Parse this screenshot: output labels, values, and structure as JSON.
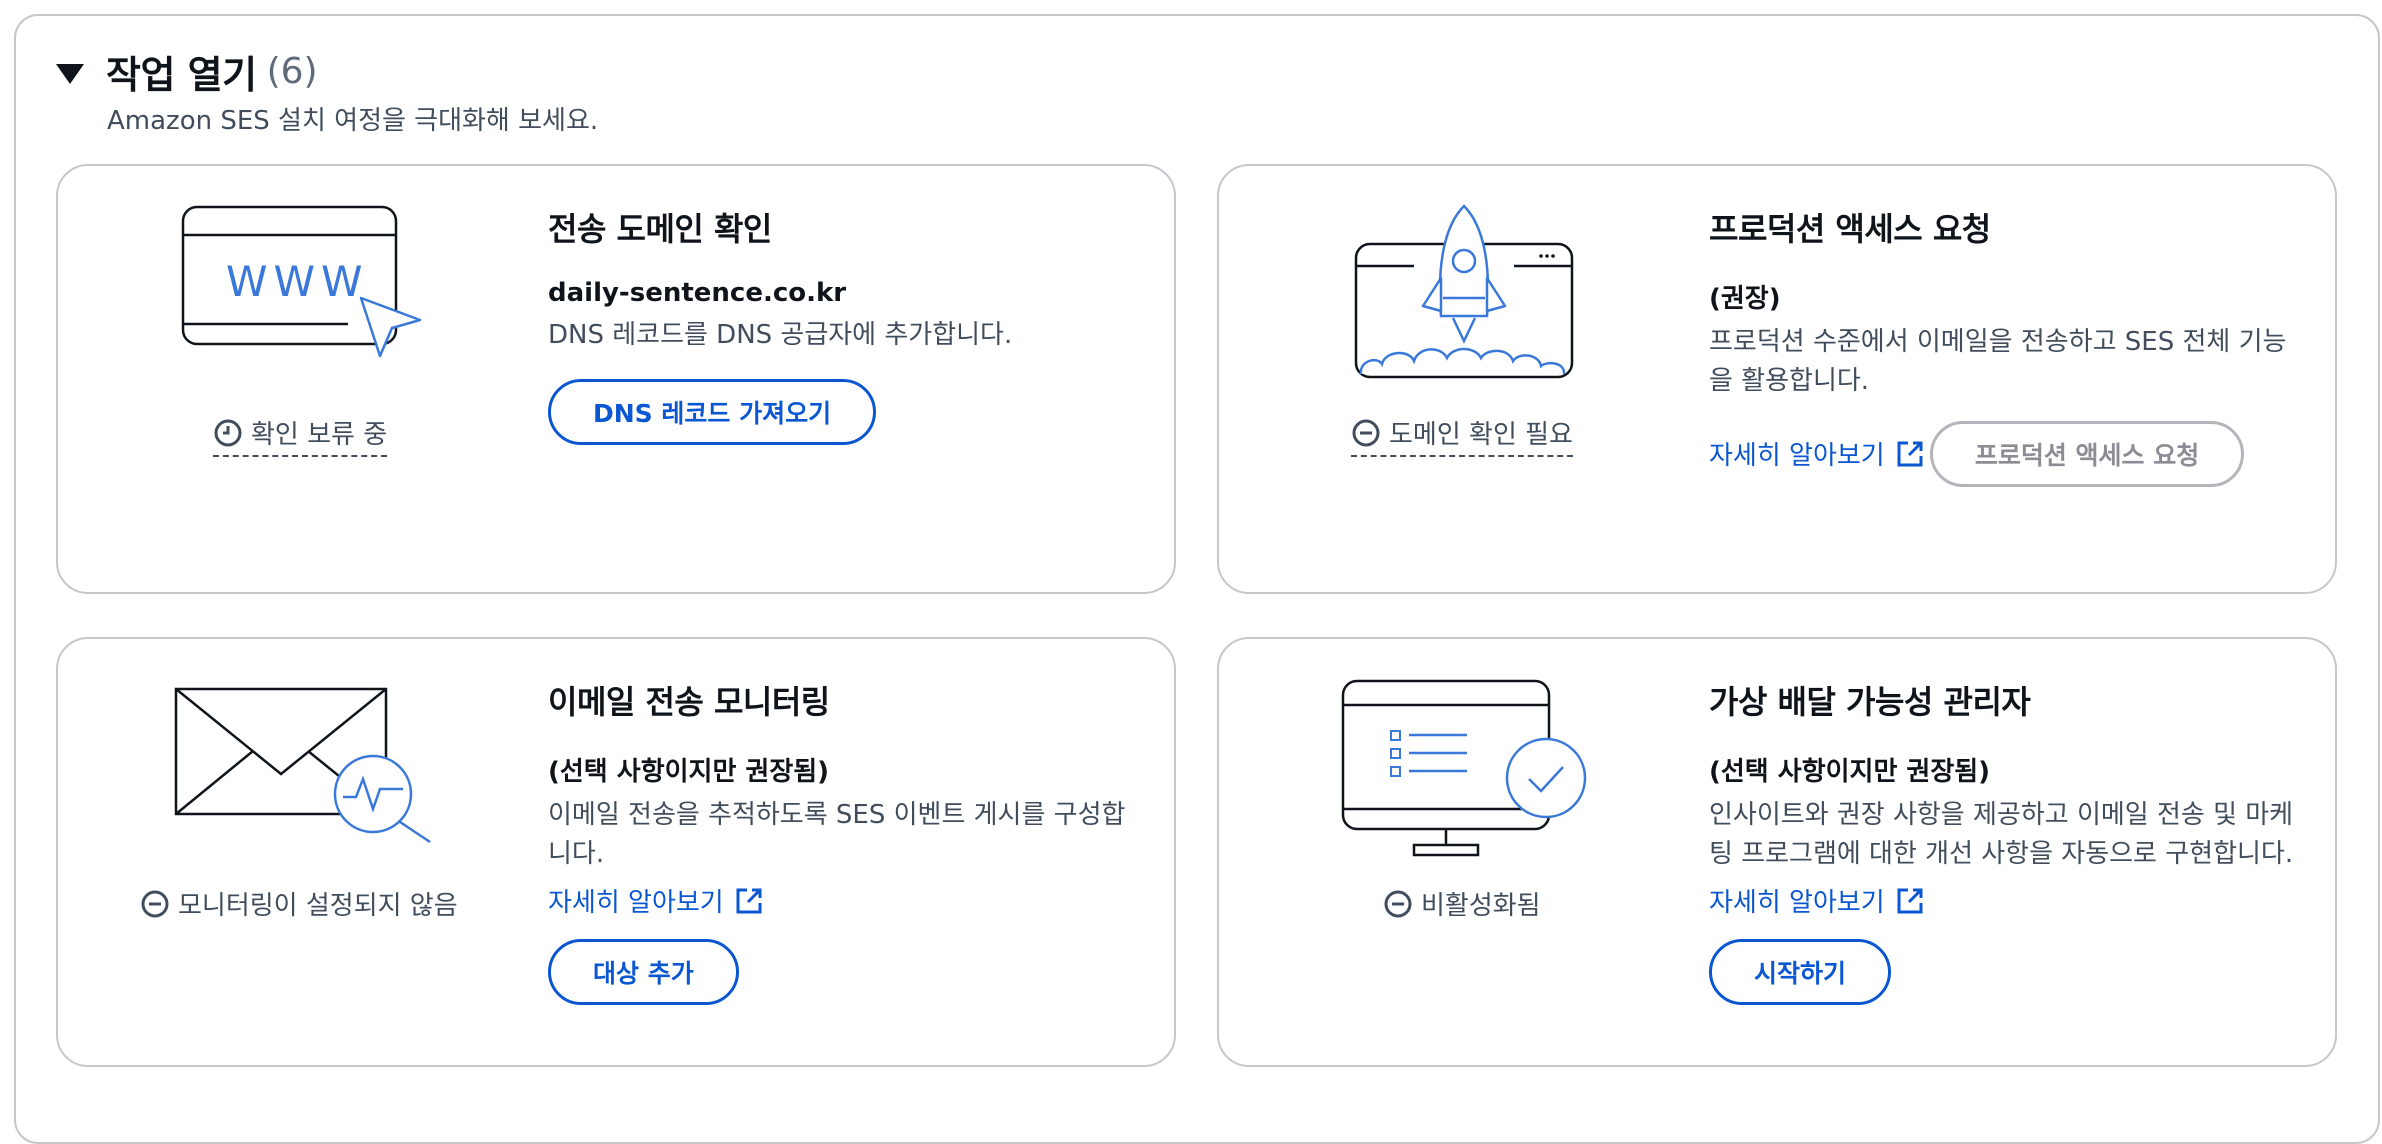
{
  "header": {
    "title": "작업 열기",
    "count": "(6)",
    "subtitle": "Amazon SES 설치 여정을 극대화해 보세요."
  },
  "cards": [
    {
      "title": "전송 도메인 확인",
      "subtitle": "daily-sentence.co.kr",
      "description": "DNS 레코드를 DNS 공급자에 추가합니다.",
      "status": "확인 보류 중",
      "status_icon": "clock-icon",
      "button": "DNS 레코드 가져오기",
      "illustration_text": "WWW"
    },
    {
      "title": "프로덕션 액세스 요청",
      "subtitle": "(권장)",
      "description": "프로덕션 수준에서 이메일을 전송하고 SES 전체 기능을 활용합니다.",
      "learn_more": "자세히 알아보기",
      "status": "도메인 확인 필요",
      "status_icon": "minus-circle-icon",
      "button": "프로덕션 액세스 요청",
      "button_disabled": true
    },
    {
      "title": "이메일 전송 모니터링",
      "subtitle": "(선택 사항이지만 권장됨)",
      "description": "이메일 전송을 추적하도록 SES 이벤트 게시를 구성합니다.",
      "learn_more": "자세히 알아보기",
      "status": "모니터링이 설정되지 않음",
      "status_icon": "minus-circle-icon",
      "button": "대상 추가"
    },
    {
      "title": "가상 배달 가능성 관리자",
      "subtitle": "(선택 사항이지만 권장됨)",
      "description": "인사이트와 권장 사항을 제공하고 이메일 전송 및 마케팅 프로그램에 대한 개선 사항을 자동으로 구현합니다.",
      "learn_more": "자세히 알아보기",
      "status": "비활성화됨",
      "status_icon": "minus-circle-icon",
      "button": "시작하기"
    }
  ],
  "colors": {
    "link": "#0a57d1",
    "border": "#c6c6cd",
    "text": "#0f141a",
    "secondary_text": "#414d5c"
  }
}
